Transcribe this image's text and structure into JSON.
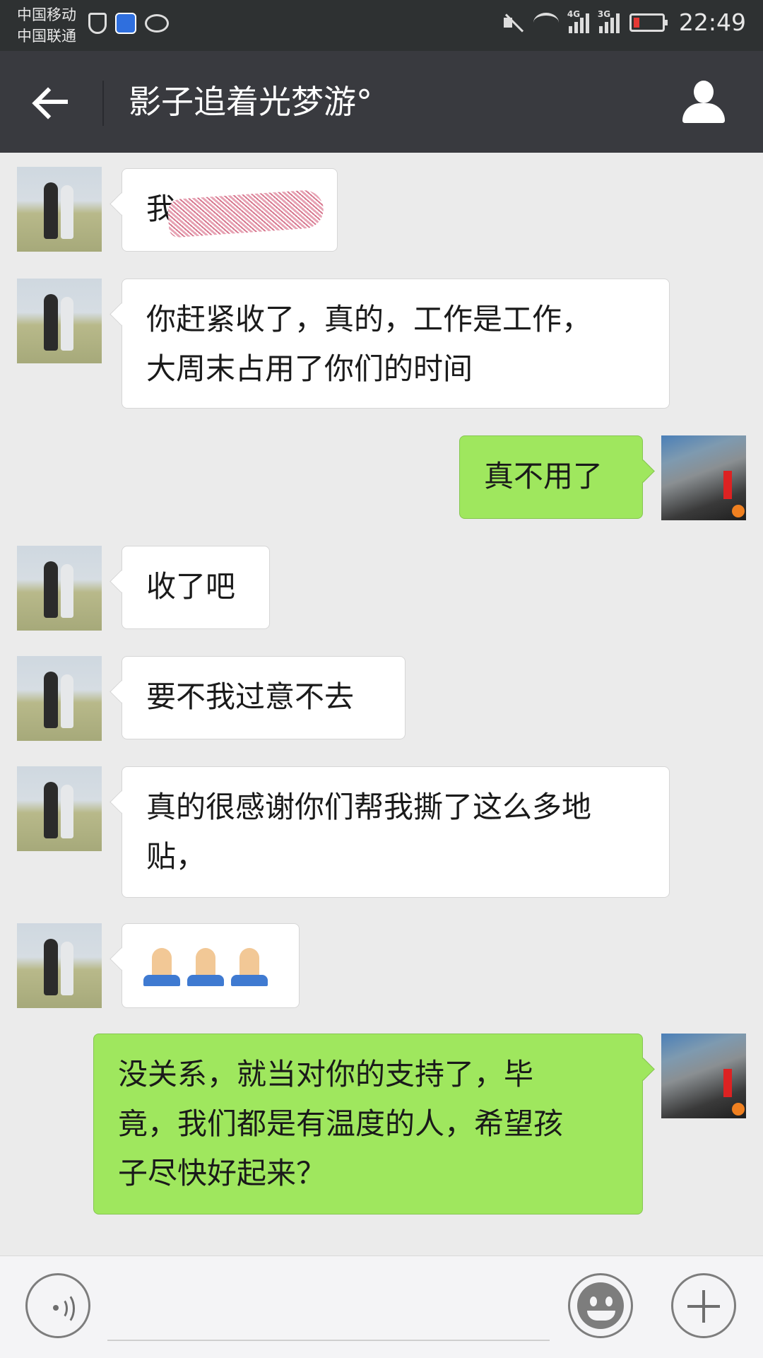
{
  "status_bar": {
    "carrier_1": "中国移动",
    "carrier_2": "中国联通",
    "signal_1_label": "4G",
    "signal_2_label": "3G",
    "time": "22:49"
  },
  "header": {
    "contact_name": "影子追着光梦游°"
  },
  "messages": [
    {
      "sender": "them",
      "text": "我",
      "redacted": true
    },
    {
      "sender": "them",
      "lines": [
        "你赶紧收了，真的，工作是工作，",
        "大周末占用了你们的时间"
      ]
    },
    {
      "sender": "me",
      "text": "真不用了"
    },
    {
      "sender": "them",
      "text": "收了吧"
    },
    {
      "sender": "them",
      "text": "要不我过意不去"
    },
    {
      "sender": "them",
      "lines": [
        "真的很感谢你们帮我撕了这么多地",
        "贴，"
      ]
    },
    {
      "sender": "them",
      "emoji": "folded-hands",
      "count": 3
    },
    {
      "sender": "me",
      "lines": [
        "没关系，就当对你的支持了，毕",
        "竟，我们都是有温度的人，希望孩",
        "子尽快好起来？"
      ]
    }
  ],
  "colors": {
    "title_bar": "#393a3f",
    "status_bar": "#2e3132",
    "chat_background": "#ebebeb",
    "my_bubble": "#9fe75e",
    "their_bubble": "#ffffff"
  }
}
